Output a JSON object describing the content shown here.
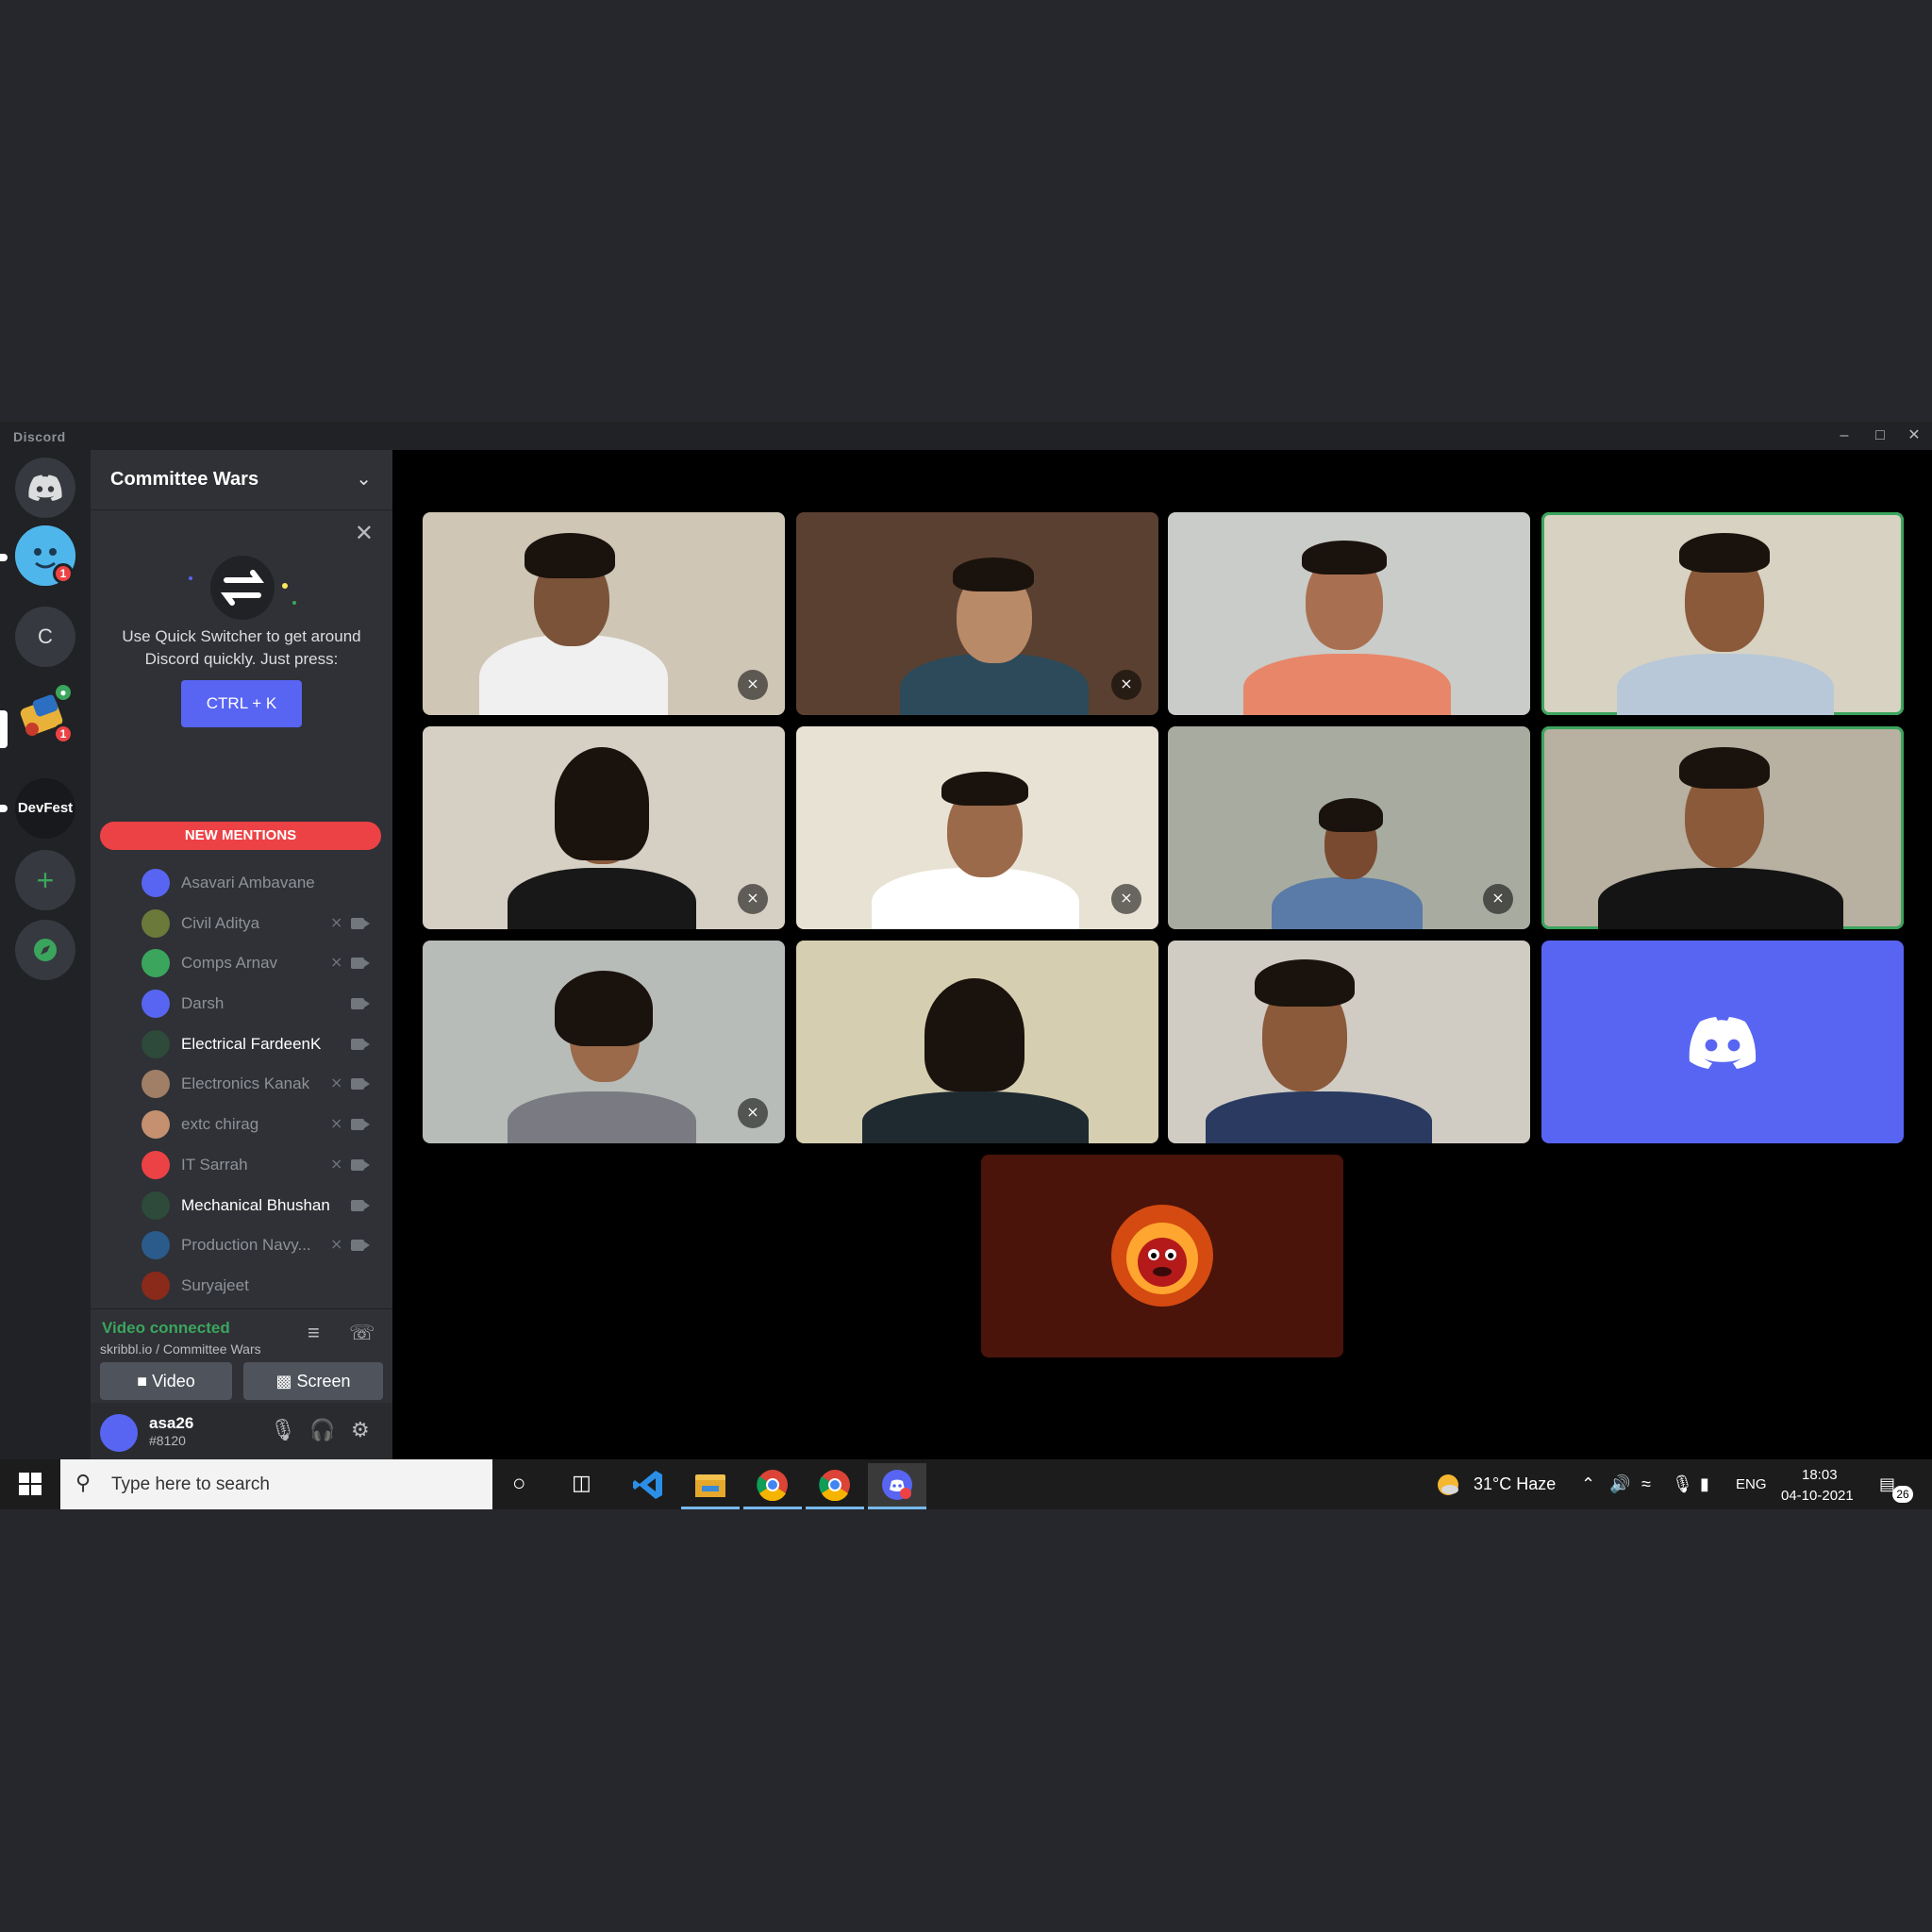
{
  "window": {
    "app_title": "Discord"
  },
  "guilds": {
    "items": [
      {
        "label": "C"
      },
      {
        "label": "DevFest"
      }
    ],
    "badges": [
      "1",
      "1"
    ]
  },
  "server": {
    "name": "Committee Wars"
  },
  "quick_switcher": {
    "text": "Use Quick Switcher to get around Discord quickly. Just press:",
    "shortcut": "CTRL + K"
  },
  "mentions": {
    "label": "NEW MENTIONS"
  },
  "members": [
    {
      "name": "Asavari Ambavane",
      "muted": false,
      "camera": false,
      "color": "#5865f2"
    },
    {
      "name": "Civil Aditya",
      "muted": true,
      "camera": true,
      "color": "#6b7a3a"
    },
    {
      "name": "Comps Arnav",
      "muted": true,
      "camera": true,
      "color": "#3ba55d"
    },
    {
      "name": "Darsh",
      "muted": false,
      "camera": true,
      "color": "#5865f2"
    },
    {
      "name": "Electrical FardeenK",
      "muted": false,
      "camera": true,
      "color": "#2d4a3a",
      "active": true
    },
    {
      "name": "Electronics Kanak",
      "muted": true,
      "camera": true,
      "color": "#a07f66"
    },
    {
      "name": "extc chirag",
      "muted": true,
      "camera": true,
      "color": "#c49070"
    },
    {
      "name": "IT Sarrah",
      "muted": true,
      "camera": true,
      "color": "#ed4245"
    },
    {
      "name": "Mechanical Bhushan",
      "muted": false,
      "camera": true,
      "color": "#2d4a3a",
      "active": true
    },
    {
      "name": "Production Navy...",
      "muted": true,
      "camera": true,
      "color": "#2a5b8a"
    },
    {
      "name": "Suryajeet",
      "muted": false,
      "camera": false,
      "color": "#8a2a1a"
    }
  ],
  "voice": {
    "status": "Video connected",
    "channel": "skribbl.io / Committee Wars",
    "video_label": "Video",
    "screen_label": "Screen"
  },
  "user": {
    "name": "asa26",
    "tag": "#8120"
  },
  "taskbar": {
    "search_placeholder": "Type here to search",
    "weather": "31°C  Haze",
    "language": "ENG",
    "time": "18:03",
    "date": "04-10-2021",
    "notifications": "26"
  },
  "colors": {
    "blurple": "#5865f2",
    "green": "#3ba55d",
    "red": "#ed4245",
    "avatar_bg": "#4a140a"
  }
}
